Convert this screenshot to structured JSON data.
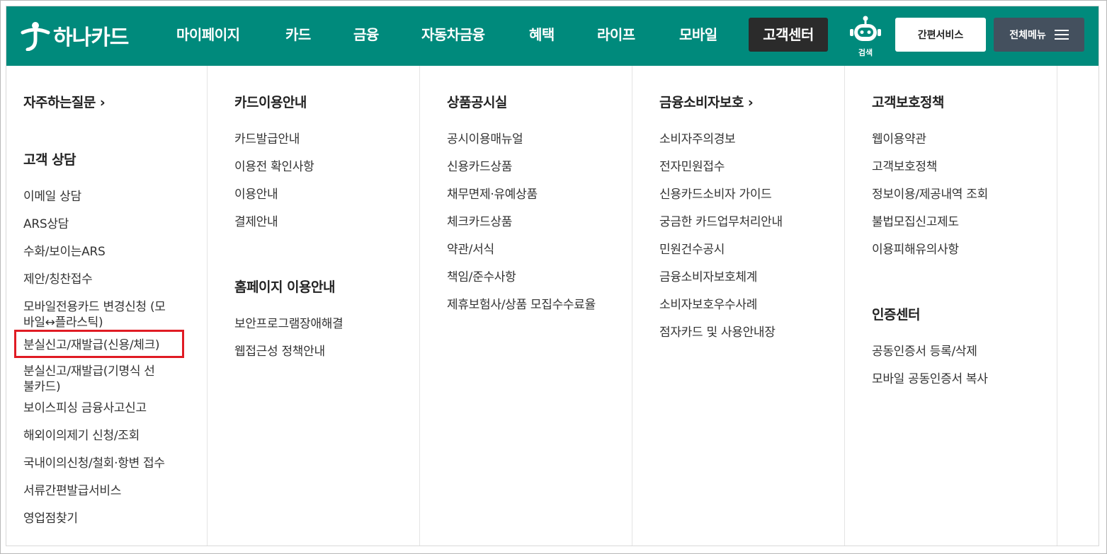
{
  "header": {
    "logo_text": "하나카드",
    "nav": [
      "마이페이지",
      "카드",
      "금융",
      "자동차금융",
      "혜택",
      "라이프",
      "모바일",
      "고객센터"
    ],
    "active_nav": "고객센터",
    "search_label": "검색",
    "simple_service_label": "간편서비스",
    "all_menu_label": "전체메뉴"
  },
  "colors": {
    "brand_green": "#008a7c",
    "active_nav_bg": "#2b2b2b",
    "all_menu_bg": "#44505e",
    "highlight": "#e01b24"
  },
  "menu": {
    "col1": {
      "faq_title": "자주하는질문",
      "consult_title": "고객 상담",
      "links": [
        "이메일 상담",
        "ARS상담",
        "수화/보이는ARS",
        "제안/칭찬접수",
        "모바일전용카드 변경신청 (모바일↔플라스틱)",
        "분실신고/재발급(신용/체크)",
        "분실신고/재발급(기명식 선불카드)",
        "보이스피싱 금융사고신고",
        "해외이의제기 신청/조회",
        "국내이의신청/철회·항변 접수",
        "서류간편발급서비스",
        "영업점찾기"
      ],
      "highlighted_link": "분실신고/재발급(신용/체크)"
    },
    "col2": {
      "title": "카드이용안내",
      "links": [
        "카드발급안내",
        "이용전 확인사항",
        "이용안내",
        "결제안내"
      ],
      "title2": "홈페이지 이용안내",
      "links2": [
        "보안프로그램장애해결",
        "웹접근성 정책안내"
      ]
    },
    "col3": {
      "title": "상품공시실",
      "links": [
        "공시이용매뉴얼",
        "신용카드상품",
        "채무면제·유예상품",
        "체크카드상품",
        "약관/서식",
        "책임/준수사항",
        "제휴보험사/상품 모집수수료율"
      ]
    },
    "col4": {
      "title": "금융소비자보호",
      "links": [
        "소비자주의경보",
        "전자민원접수",
        "신용카드소비자 가이드",
        "궁금한 카드업무처리안내",
        "민원건수공시",
        "금융소비자보호체계",
        "소비자보호우수사례",
        "점자카드 및 사용안내장"
      ]
    },
    "col5": {
      "title": "고객보호정책",
      "links": [
        "웹이용약관",
        "고객보호정책",
        "정보이용/제공내역 조회",
        "불법모집신고제도",
        "이용피해유의사항"
      ],
      "title2": "인증센터",
      "links2": [
        "공동인증서 등록/삭제",
        "모바일 공동인증서 복사"
      ]
    }
  }
}
